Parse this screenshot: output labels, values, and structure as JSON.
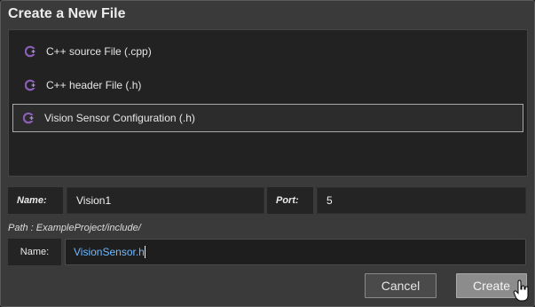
{
  "dialog": {
    "title": "Create a New File"
  },
  "file_types": [
    {
      "label": "C++ source File (.cpp)",
      "icon": "cpp-file-icon",
      "selected": false
    },
    {
      "label": "C++ header File (.h)",
      "icon": "cpp-file-icon",
      "selected": false
    },
    {
      "label": "Vision Sensor Configuration (.h)",
      "icon": "cpp-file-icon",
      "selected": true
    }
  ],
  "fields": {
    "name_label": "Name:",
    "name_value": "Vision1",
    "port_label": "Port:",
    "port_value": "5"
  },
  "path": {
    "text": "Path : ExampleProject/include/"
  },
  "filename": {
    "label": "Name:",
    "value": "VisionSensor.h"
  },
  "buttons": {
    "cancel": "Cancel",
    "create": "Create"
  },
  "colors": {
    "icon_accent": "#8a5fb7",
    "filename_text": "#6fb8ff"
  }
}
